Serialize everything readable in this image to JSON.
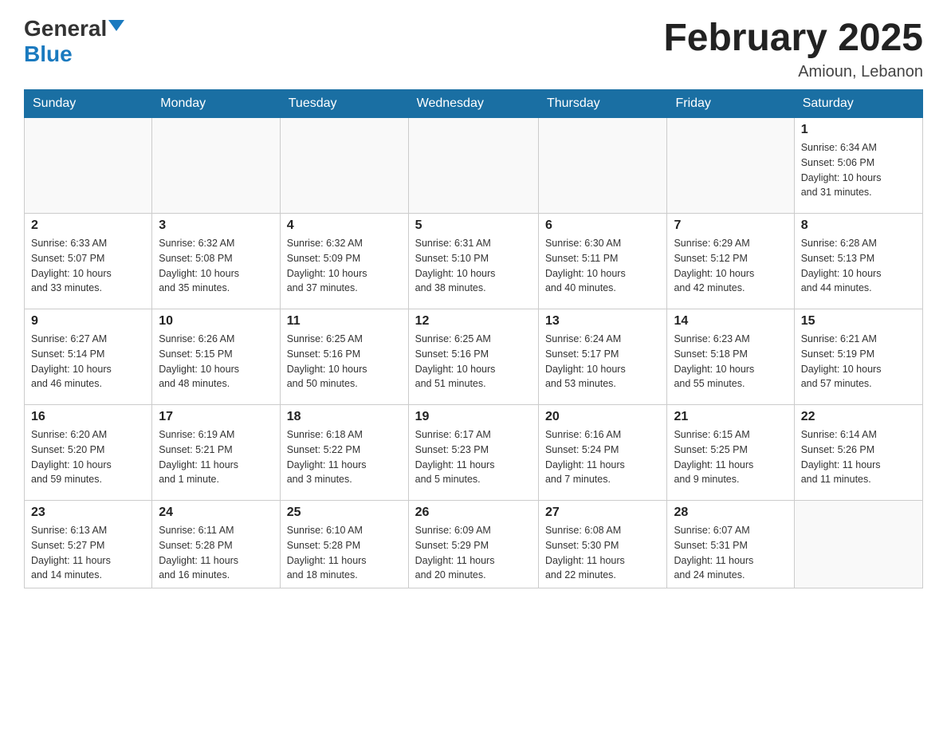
{
  "header": {
    "logo_general": "General",
    "logo_blue": "Blue",
    "month_title": "February 2025",
    "location": "Amioun, Lebanon"
  },
  "days_of_week": [
    "Sunday",
    "Monday",
    "Tuesday",
    "Wednesday",
    "Thursday",
    "Friday",
    "Saturday"
  ],
  "weeks": [
    [
      {
        "day": "",
        "info": ""
      },
      {
        "day": "",
        "info": ""
      },
      {
        "day": "",
        "info": ""
      },
      {
        "day": "",
        "info": ""
      },
      {
        "day": "",
        "info": ""
      },
      {
        "day": "",
        "info": ""
      },
      {
        "day": "1",
        "info": "Sunrise: 6:34 AM\nSunset: 5:06 PM\nDaylight: 10 hours\nand 31 minutes."
      }
    ],
    [
      {
        "day": "2",
        "info": "Sunrise: 6:33 AM\nSunset: 5:07 PM\nDaylight: 10 hours\nand 33 minutes."
      },
      {
        "day": "3",
        "info": "Sunrise: 6:32 AM\nSunset: 5:08 PM\nDaylight: 10 hours\nand 35 minutes."
      },
      {
        "day": "4",
        "info": "Sunrise: 6:32 AM\nSunset: 5:09 PM\nDaylight: 10 hours\nand 37 minutes."
      },
      {
        "day": "5",
        "info": "Sunrise: 6:31 AM\nSunset: 5:10 PM\nDaylight: 10 hours\nand 38 minutes."
      },
      {
        "day": "6",
        "info": "Sunrise: 6:30 AM\nSunset: 5:11 PM\nDaylight: 10 hours\nand 40 minutes."
      },
      {
        "day": "7",
        "info": "Sunrise: 6:29 AM\nSunset: 5:12 PM\nDaylight: 10 hours\nand 42 minutes."
      },
      {
        "day": "8",
        "info": "Sunrise: 6:28 AM\nSunset: 5:13 PM\nDaylight: 10 hours\nand 44 minutes."
      }
    ],
    [
      {
        "day": "9",
        "info": "Sunrise: 6:27 AM\nSunset: 5:14 PM\nDaylight: 10 hours\nand 46 minutes."
      },
      {
        "day": "10",
        "info": "Sunrise: 6:26 AM\nSunset: 5:15 PM\nDaylight: 10 hours\nand 48 minutes."
      },
      {
        "day": "11",
        "info": "Sunrise: 6:25 AM\nSunset: 5:16 PM\nDaylight: 10 hours\nand 50 minutes."
      },
      {
        "day": "12",
        "info": "Sunrise: 6:25 AM\nSunset: 5:16 PM\nDaylight: 10 hours\nand 51 minutes."
      },
      {
        "day": "13",
        "info": "Sunrise: 6:24 AM\nSunset: 5:17 PM\nDaylight: 10 hours\nand 53 minutes."
      },
      {
        "day": "14",
        "info": "Sunrise: 6:23 AM\nSunset: 5:18 PM\nDaylight: 10 hours\nand 55 minutes."
      },
      {
        "day": "15",
        "info": "Sunrise: 6:21 AM\nSunset: 5:19 PM\nDaylight: 10 hours\nand 57 minutes."
      }
    ],
    [
      {
        "day": "16",
        "info": "Sunrise: 6:20 AM\nSunset: 5:20 PM\nDaylight: 10 hours\nand 59 minutes."
      },
      {
        "day": "17",
        "info": "Sunrise: 6:19 AM\nSunset: 5:21 PM\nDaylight: 11 hours\nand 1 minute."
      },
      {
        "day": "18",
        "info": "Sunrise: 6:18 AM\nSunset: 5:22 PM\nDaylight: 11 hours\nand 3 minutes."
      },
      {
        "day": "19",
        "info": "Sunrise: 6:17 AM\nSunset: 5:23 PM\nDaylight: 11 hours\nand 5 minutes."
      },
      {
        "day": "20",
        "info": "Sunrise: 6:16 AM\nSunset: 5:24 PM\nDaylight: 11 hours\nand 7 minutes."
      },
      {
        "day": "21",
        "info": "Sunrise: 6:15 AM\nSunset: 5:25 PM\nDaylight: 11 hours\nand 9 minutes."
      },
      {
        "day": "22",
        "info": "Sunrise: 6:14 AM\nSunset: 5:26 PM\nDaylight: 11 hours\nand 11 minutes."
      }
    ],
    [
      {
        "day": "23",
        "info": "Sunrise: 6:13 AM\nSunset: 5:27 PM\nDaylight: 11 hours\nand 14 minutes."
      },
      {
        "day": "24",
        "info": "Sunrise: 6:11 AM\nSunset: 5:28 PM\nDaylight: 11 hours\nand 16 minutes."
      },
      {
        "day": "25",
        "info": "Sunrise: 6:10 AM\nSunset: 5:28 PM\nDaylight: 11 hours\nand 18 minutes."
      },
      {
        "day": "26",
        "info": "Sunrise: 6:09 AM\nSunset: 5:29 PM\nDaylight: 11 hours\nand 20 minutes."
      },
      {
        "day": "27",
        "info": "Sunrise: 6:08 AM\nSunset: 5:30 PM\nDaylight: 11 hours\nand 22 minutes."
      },
      {
        "day": "28",
        "info": "Sunrise: 6:07 AM\nSunset: 5:31 PM\nDaylight: 11 hours\nand 24 minutes."
      },
      {
        "day": "",
        "info": ""
      }
    ]
  ]
}
